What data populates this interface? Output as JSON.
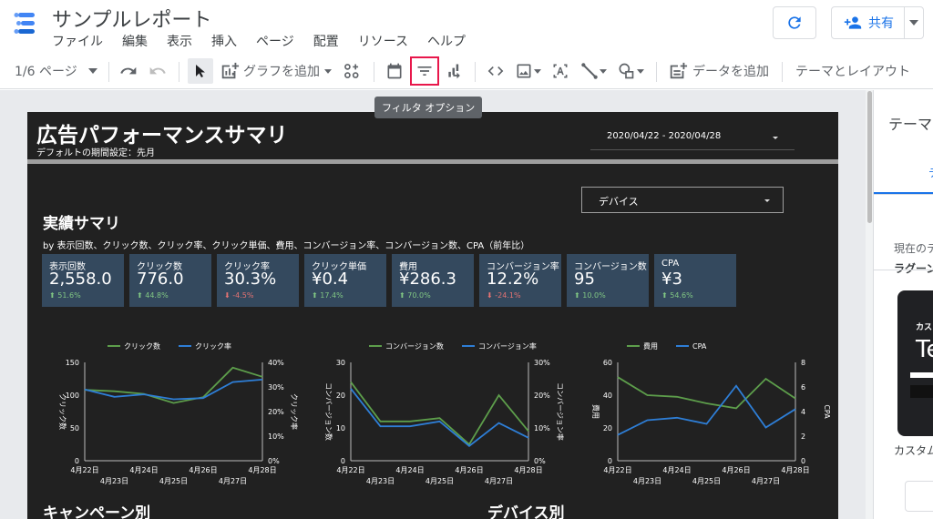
{
  "app": {
    "title": "サンプルレポート",
    "menu": [
      "ファイル",
      "編集",
      "表示",
      "挿入",
      "ページ",
      "配置",
      "リソース",
      "ヘルプ"
    ],
    "share_label": "共有"
  },
  "toolbar": {
    "page_indicator": "1/6 ページ",
    "add_chart": "グラフを追加",
    "add_data": "データを追加",
    "theme_layout": "テーマとレイアウト",
    "tooltip": "フィルタ オプション"
  },
  "report": {
    "title": "広告パフォーマンスサマリ",
    "subtitle": "デフォルトの期間設定：先月",
    "date_range": "2020/04/22 - 2020/04/28",
    "device_filter": "デバイス",
    "section_title": "実績サマリ",
    "section_sub": "by 表示回数、クリック数、クリック率、クリック単価、費用、コンバージョン率、コンバージョン数、CPA（前年比）",
    "campaign_title": "キャンペーン別",
    "device_title": "デバイス別",
    "kpis": [
      {
        "label": "表示回数",
        "value": "2,558.0",
        "delta": "51.6%",
        "dir": "up"
      },
      {
        "label": "クリック数",
        "value": "776.0",
        "delta": "44.8%",
        "dir": "up"
      },
      {
        "label": "クリック率",
        "value": "30.3%",
        "delta": "-4.5%",
        "dir": "down"
      },
      {
        "label": "クリック単価",
        "value": "¥0.4",
        "delta": "17.4%",
        "dir": "up"
      },
      {
        "label": "費用",
        "value": "¥286.3",
        "delta": "70.0%",
        "dir": "up"
      },
      {
        "label": "コンバージョン率",
        "value": "12.2%",
        "delta": "-24.1%",
        "dir": "down"
      },
      {
        "label": "コンバージョン数",
        "value": "95",
        "delta": "10.0%",
        "dir": "up"
      },
      {
        "label": "CPA",
        "value": "¥3",
        "delta": "54.6%",
        "dir": "up"
      }
    ]
  },
  "panel": {
    "title": "テーマ",
    "tab": "テ",
    "current": "現在のテ",
    "theme_name": "ラグーン",
    "card_t1": "カス",
    "card_t2": "Te",
    "custom": "カスタム"
  },
  "colors": {
    "green": "#5d9e4b",
    "blue": "#2e7ed6",
    "kpi_bg": "#34495e",
    "report_bg": "#212121",
    "highlight": "#e8174b"
  },
  "chart_data": [
    {
      "type": "line",
      "x": [
        "4月22日",
        "4月23日",
        "4月24日",
        "4月25日",
        "4月26日",
        "4月27日",
        "4月28日"
      ],
      "xtick_labels_top": [
        "4月22日",
        "4月24日",
        "4月26日",
        "4月28日"
      ],
      "xtick_labels_bottom": [
        "4月23日",
        "4月25日",
        "4月27日"
      ],
      "series": [
        {
          "name": "クリック数",
          "axis": "left",
          "color": "#5d9e4b",
          "values": [
            108,
            106,
            102,
            88,
            97,
            142,
            128
          ]
        },
        {
          "name": "クリック率",
          "axis": "right",
          "color": "#2e7ed6",
          "values": [
            0.29,
            0.26,
            0.27,
            0.25,
            0.255,
            0.32,
            0.33
          ]
        }
      ],
      "ylabel_left": "クリック数",
      "ylim_left": [
        0,
        150
      ],
      "yticks_left": [
        "0",
        "50",
        "100",
        "150"
      ],
      "ylabel_right": "クリック率",
      "ylim_right": [
        0,
        0.4
      ],
      "yticks_right": [
        "0%",
        "10%",
        "20%",
        "30%",
        "40%"
      ]
    },
    {
      "type": "line",
      "x": [
        "4月22日",
        "4月23日",
        "4月24日",
        "4月25日",
        "4月26日",
        "4月27日",
        "4月28日"
      ],
      "xtick_labels_top": [
        "4月22日",
        "4月24日",
        "4月26日",
        "4月28日"
      ],
      "xtick_labels_bottom": [
        "4月23日",
        "4月25日",
        "4月27日"
      ],
      "series": [
        {
          "name": "コンバージョン数",
          "axis": "left",
          "color": "#5d9e4b",
          "values": [
            24,
            12,
            12,
            13,
            5,
            20,
            9
          ]
        },
        {
          "name": "コンバージョン率",
          "axis": "right",
          "color": "#2e7ed6",
          "values": [
            0.22,
            0.105,
            0.105,
            0.12,
            0.045,
            0.115,
            0.07
          ]
        }
      ],
      "ylabel_left": "コンバージョン数",
      "ylim_left": [
        0,
        30
      ],
      "yticks_left": [
        "0",
        "10",
        "20",
        "30"
      ],
      "ylabel_right": "コンバージョン率",
      "ylim_right": [
        0,
        0.3
      ],
      "yticks_right": [
        "0%",
        "10%",
        "20%",
        "30%"
      ]
    },
    {
      "type": "line",
      "x": [
        "4月22日",
        "4月23日",
        "4月24日",
        "4月25日",
        "4月26日",
        "4月27日",
        "4月28日"
      ],
      "xtick_labels_top": [
        "4月22日",
        "4月24日",
        "4月26日",
        "4月28日"
      ],
      "xtick_labels_bottom": [
        "4月23日",
        "4月25日",
        "4月27日"
      ],
      "series": [
        {
          "name": "費用",
          "axis": "left",
          "color": "#5d9e4b",
          "values": [
            51,
            40,
            39,
            35,
            32,
            50,
            38
          ]
        },
        {
          "name": "CPA",
          "axis": "right",
          "color": "#2e7ed6",
          "values": [
            2.1,
            3.3,
            3.5,
            3.0,
            6.1,
            2.7,
            4.2
          ]
        }
      ],
      "ylabel_left": "費用",
      "ylim_left": [
        0,
        60
      ],
      "yticks_left": [
        "0",
        "20",
        "40",
        "60"
      ],
      "ylabel_right": "CPA",
      "ylim_right": [
        0,
        8
      ],
      "yticks_right": [
        "0",
        "2",
        "4",
        "6",
        "8"
      ]
    }
  ]
}
